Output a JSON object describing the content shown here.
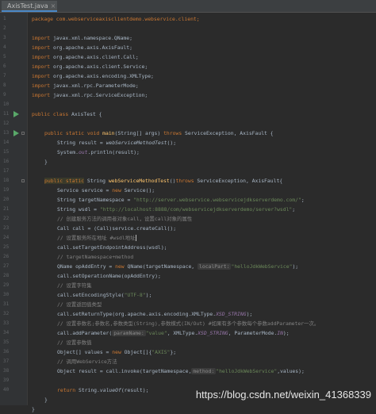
{
  "tab": {
    "label": "AxisTest.java",
    "close": "×"
  },
  "line_numbers": [
    "1",
    "2",
    "3",
    "4",
    "5",
    "6",
    "7",
    "8",
    "9",
    "10",
    "11",
    "12",
    "13",
    "14",
    "15",
    "16",
    "17",
    "18",
    "19",
    "20",
    "21",
    "22",
    "23",
    "24",
    "25",
    "26",
    "27",
    "28",
    "29",
    "30",
    "31",
    "32",
    "33",
    "34",
    "35",
    "36",
    "37",
    "38",
    "39",
    "40"
  ],
  "code": {
    "l1": "package com.webserviceaxisclientdemo.webservice.client;",
    "l3_kw": "import",
    "l3": " javax.xml.namespace.QName;",
    "l4_kw": "import",
    "l4": " org.apache.axis.AxisFault;",
    "l5_kw": "import",
    "l5": " org.apache.axis.client.Call;",
    "l6_kw": "import",
    "l6": " org.apache.axis.client.Service;",
    "l7_kw": "import",
    "l7": " org.apache.axis.encoding.XMLType;",
    "l8_kw": "import",
    "l8": " javax.xml.rpc.ParameterMode;",
    "l9_kw": "import",
    "l9": " javax.xml.rpc.ServiceException;",
    "l11_kw": "public class",
    "l11": " AxisTest {",
    "l13_kw": "public static void",
    "l13_fn": "main",
    "l13": "(String[] args) ",
    "l13_kw2": "throws",
    "l13b": " ServiceException, AxisFault {",
    "l14": "String result = ",
    "l14_fn": "webServiceMethodTest",
    "l14b": "();",
    "l15": "System.",
    "l15_fld": "out",
    "l15b": ".println(result);",
    "l16": "}",
    "l18_kw": "public static",
    "l18": " String ",
    "l18_fn": "webServiceMethodTest",
    "l18b": "()",
    "l18_kw2": "throws",
    "l18c": " ServiceException, AxisFault{",
    "l19": "Service service = ",
    "l19_kw": "new",
    "l19b": " Service();",
    "l20": "String targetNamespace = ",
    "l20_str": "\"http://server.webservice.webservicejdkserverdemo.com/\"",
    "l21": "String wsdl = ",
    "l21_str": "\"http://localhost:8888/com/webservicejdkserverdemo/server?wsdl\"",
    "l22": "// 创建服务方法的调用者对象call，设置call对象的属性",
    "l23": "Call call = (Call)service.createCall();",
    "l24": "// 设置服务所在地址 #wsdl地址",
    "l25": "call.setTargetEndpointAddress(wsdl);",
    "l26": "// targetNamespace+method",
    "l27": "QName opAddEntry = ",
    "l27_kw": "new",
    "l27b": " QName(targetNamespace, ",
    "l27_hint": "localPart:",
    "l27_str": "\"helloJdkWebService\"",
    "l27c": ");",
    "l28": "call.setOperationName(opAddEntry);",
    "l29": "// 设置字符集",
    "l30": "call.setEncodingStyle(",
    "l30_str": "\"UTF-8\"",
    "l30b": ");",
    "l31": "// 设置返回值类型",
    "l32": "call.setReturnType(org.apache.axis.encoding.XMLType.",
    "l32_fld": "XSD_STRING",
    "l32b": ");",
    "l33": "// 设置参数名;参数名,参数类型(String),参数模式(IN/Out) #如果有多个参数每个参数addParameter一次。",
    "l34": "call.addParameter(",
    "l34_hint": "paramName:",
    "l34_str": "\"value\"",
    "l34b": ", XMLType.",
    "l34_fld": "XSD_STRING",
    "l34c": ", ParameterMode.",
    "l34_fld2": "IN",
    "l34d": ");",
    "l35": "// 设置参数值",
    "l36": "Object[] values = ",
    "l36_kw": "new",
    "l36b": " Object[]{",
    "l36_str": "\"AXIS\"",
    "l36c": "};",
    "l37": "// 调用WebService方法",
    "l38": "Object result = call.invoke(targetNamespace,",
    "l38_hint": "method:",
    "l38_str": "\"helloJdkWebService\"",
    "l38b": ",values);",
    "l40_kw": "return",
    "l40": " String.",
    "l40_fn": "valueOf",
    "l40b": "(result);",
    "l41": "}",
    "l42": "}"
  },
  "watermark": "https://blog.csdn.net/weixin_41368339"
}
